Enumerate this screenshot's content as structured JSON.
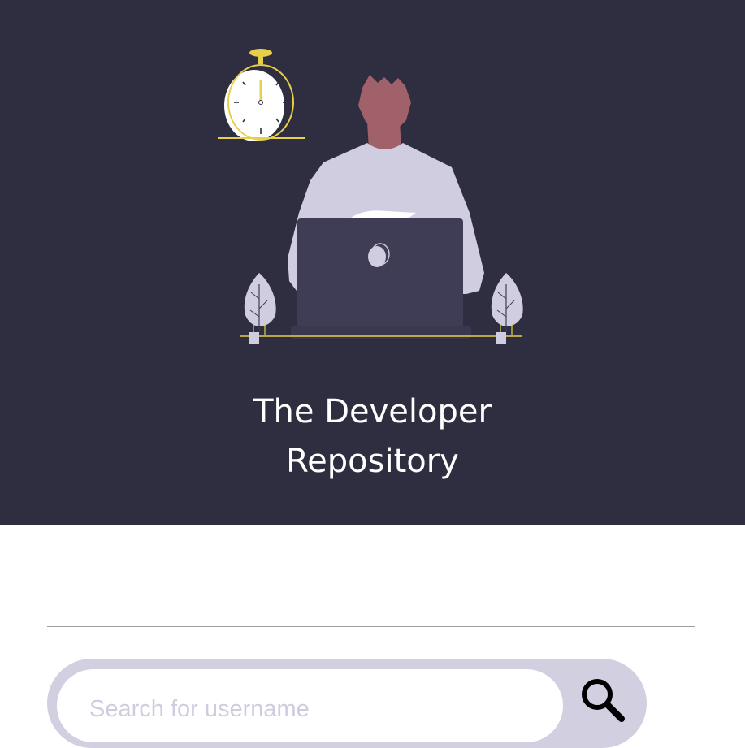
{
  "hero": {
    "title_line1": "The Developer",
    "title_line2": "Repository",
    "background_color": "#2f2e41",
    "accent_color": "#e6d04a",
    "illustration": [
      "stopwatch-icon",
      "developer-figure",
      "laptop-icon",
      "plant-icon",
      "plant-icon"
    ]
  },
  "search": {
    "placeholder": "Search for username",
    "value": "",
    "button_icon": "search-icon",
    "bar_color": "#d2cfe1"
  }
}
